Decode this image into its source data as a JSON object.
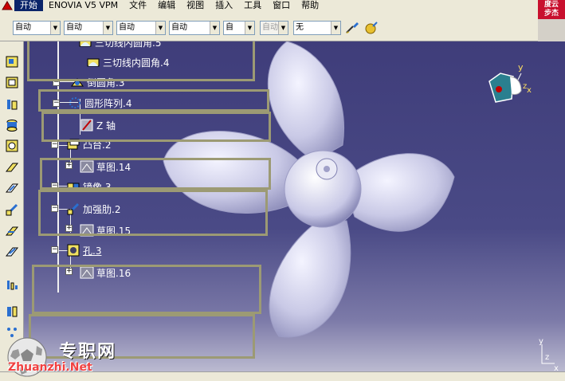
{
  "menu": {
    "items": [
      "开始",
      "ENOVIA V5 VPM",
      "文件",
      "编辑",
      "视图",
      "插入",
      "工具",
      "窗口",
      "帮助"
    ],
    "active_index": 0
  },
  "brand_seal": {
    "line1": "度云",
    "line2": "步杰"
  },
  "toolbar": {
    "combos": [
      {
        "value": "自动",
        "disabled": false
      },
      {
        "value": "自动",
        "disabled": false
      },
      {
        "value": "自动",
        "disabled": false
      },
      {
        "value": "自动",
        "disabled": false
      },
      {
        "value": "自",
        "disabled": false
      },
      {
        "value": "自动",
        "disabled": true
      },
      {
        "value": "无",
        "disabled": false
      }
    ]
  },
  "tree": {
    "items": [
      {
        "label": "三切线内圆角.5",
        "icon": "tritangent-fillet-icon"
      },
      {
        "label": "三切线内圆角.4",
        "icon": "tritangent-fillet-icon"
      },
      {
        "label": "倒圆角.3",
        "icon": "edge-fillet-icon"
      },
      {
        "label": "圆形阵列.4",
        "icon": "circular-pattern-icon"
      },
      {
        "label": "Z 轴",
        "icon": "axis-icon"
      },
      {
        "label": "凸台.2",
        "icon": "pad-icon"
      },
      {
        "label": "草图.14",
        "icon": "sketch-icon"
      },
      {
        "label": "镜像.3",
        "icon": "mirror-icon"
      },
      {
        "label": "加强肋.2",
        "icon": "rib-icon"
      },
      {
        "label": "草图.15",
        "icon": "sketch-icon"
      },
      {
        "label": "孔.3",
        "icon": "hole-icon"
      },
      {
        "label": "草图.16",
        "icon": "sketch-icon"
      }
    ]
  },
  "compass": {
    "x_label": "x",
    "y_label": "y",
    "z_label": "z"
  },
  "mini_axis": {
    "y_label": "y",
    "z_label": "z",
    "x_label": "x"
  },
  "watermark": {
    "line1": "专职网",
    "line2": "Zhuanzhi.Net"
  },
  "colors": {
    "tree_text": "#ffffff",
    "viewport_top": "#3f3d7a",
    "highlight_box": "#9c9a74",
    "propeller": "#d6d6ee"
  }
}
